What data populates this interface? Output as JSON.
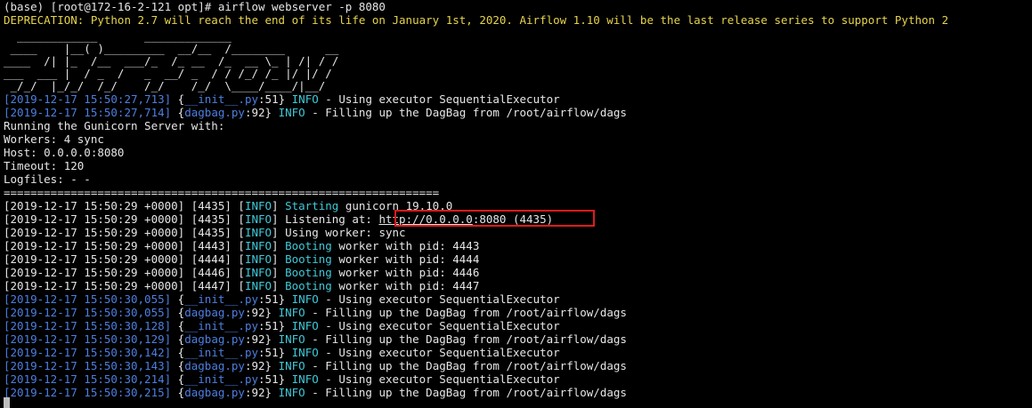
{
  "prompt_line": "(base) [root@172-16-2-121 opt]# airflow webserver -p 8080",
  "deprecation": "DEPRECATION: Python 2.7 will reach the end of its life on January 1st, 2020. Airflow 1.10 will be the last release series to support Python 2",
  "ascii_banner": [
    "  ____________       _____________",
    " ____    |__( )_________  __/__  /________      __",
    "____  /| |_  /__  ___/_  /_ __  /_  __ \\_ | /| / /",
    "___  ___ |  / _  /   _  __/ _  / / /_/ /_ |/ |/ /",
    " _/_/  |_/_/  /_/    /_/    /_/  \\____/____/|__/"
  ],
  "log_top": [
    {
      "ts": "[2019-12-17 15:50:27,713]",
      "src": "__init__.py",
      "lineno": ":51",
      "level": "INFO",
      "msg": " - Using executor SequentialExecutor"
    },
    {
      "ts": "[2019-12-17 15:50:27,714]",
      "src": "dagbag.py",
      "lineno": ":92",
      "level": "INFO",
      "msg": " - Filling up the DagBag from /root/airflow/dags"
    }
  ],
  "gunicorn_info": [
    "Running the Gunicorn Server with:",
    "Workers: 4 sync",
    "Host: 0.0.0.0:8080",
    "Timeout: 120",
    "Logfiles: - -"
  ],
  "separator": "=================================================================",
  "gunicorn_log": [
    {
      "prefix": "[2019-12-17 15:50:29 +0000] [4435] [",
      "level": "INFO",
      "mid": "] ",
      "keyword": "Starting",
      "rest": " gunicorn 19.10.0"
    },
    {
      "prefix": "[2019-12-17 15:50:29 +0000] [4435] [",
      "level": "INFO",
      "mid": "] Listening at: ",
      "url": "http://0.0.0.0",
      "rest": ":8080 (4435)"
    },
    {
      "prefix": "[2019-12-17 15:50:29 +0000] [4435] [",
      "level": "INFO",
      "mid": "] Using worker: sync"
    },
    {
      "prefix": "[2019-12-17 15:50:29 +0000] [4443] [",
      "level": "INFO",
      "mid": "] ",
      "keyword": "Booting",
      "rest": " worker with pid: 4443"
    },
    {
      "prefix": "[2019-12-17 15:50:29 +0000] [4444] [",
      "level": "INFO",
      "mid": "] ",
      "keyword": "Booting",
      "rest": " worker with pid: 4444"
    },
    {
      "prefix": "[2019-12-17 15:50:29 +0000] [4446] [",
      "level": "INFO",
      "mid": "] ",
      "keyword": "Booting",
      "rest": " worker with pid: 4446"
    },
    {
      "prefix": "[2019-12-17 15:50:29 +0000] [4447] [",
      "level": "INFO",
      "mid": "] ",
      "keyword": "Booting",
      "rest": " worker with pid: 4447"
    }
  ],
  "log_bottom": [
    {
      "ts": "[2019-12-17 15:50:30,055]",
      "src": "__init__.py",
      "lineno": ":51",
      "level": "INFO",
      "msg": " - Using executor SequentialExecutor"
    },
    {
      "ts": "[2019-12-17 15:50:30,055]",
      "src": "dagbag.py",
      "lineno": ":92",
      "level": "INFO",
      "msg": " - Filling up the DagBag from /root/airflow/dags"
    },
    {
      "ts": "[2019-12-17 15:50:30,128]",
      "src": "__init__.py",
      "lineno": ":51",
      "level": "INFO",
      "msg": " - Using executor SequentialExecutor"
    },
    {
      "ts": "[2019-12-17 15:50:30,129]",
      "src": "dagbag.py",
      "lineno": ":92",
      "level": "INFO",
      "msg": " - Filling up the DagBag from /root/airflow/dags"
    },
    {
      "ts": "[2019-12-17 15:50:30,142]",
      "src": "__init__.py",
      "lineno": ":51",
      "level": "INFO",
      "msg": " - Using executor SequentialExecutor"
    },
    {
      "ts": "[2019-12-17 15:50:30,143]",
      "src": "dagbag.py",
      "lineno": ":92",
      "level": "INFO",
      "msg": " - Filling up the DagBag from /root/airflow/dags"
    },
    {
      "ts": "[2019-12-17 15:50:30,214]",
      "src": "__init__.py",
      "lineno": ":51",
      "level": "INFO",
      "msg": " - Using executor SequentialExecutor"
    },
    {
      "ts": "[2019-12-17 15:50:30,215]",
      "src": "dagbag.py",
      "lineno": ":92",
      "level": "INFO",
      "msg": " - Filling up the DagBag from /root/airflow/dags"
    }
  ],
  "colors": {
    "background": "#000000",
    "text": "#e6e6e6",
    "warning": "#e6d34c",
    "timestamp": "#4d7fe0",
    "level": "#3fc9d8",
    "highlight_border": "#e01a1a"
  }
}
